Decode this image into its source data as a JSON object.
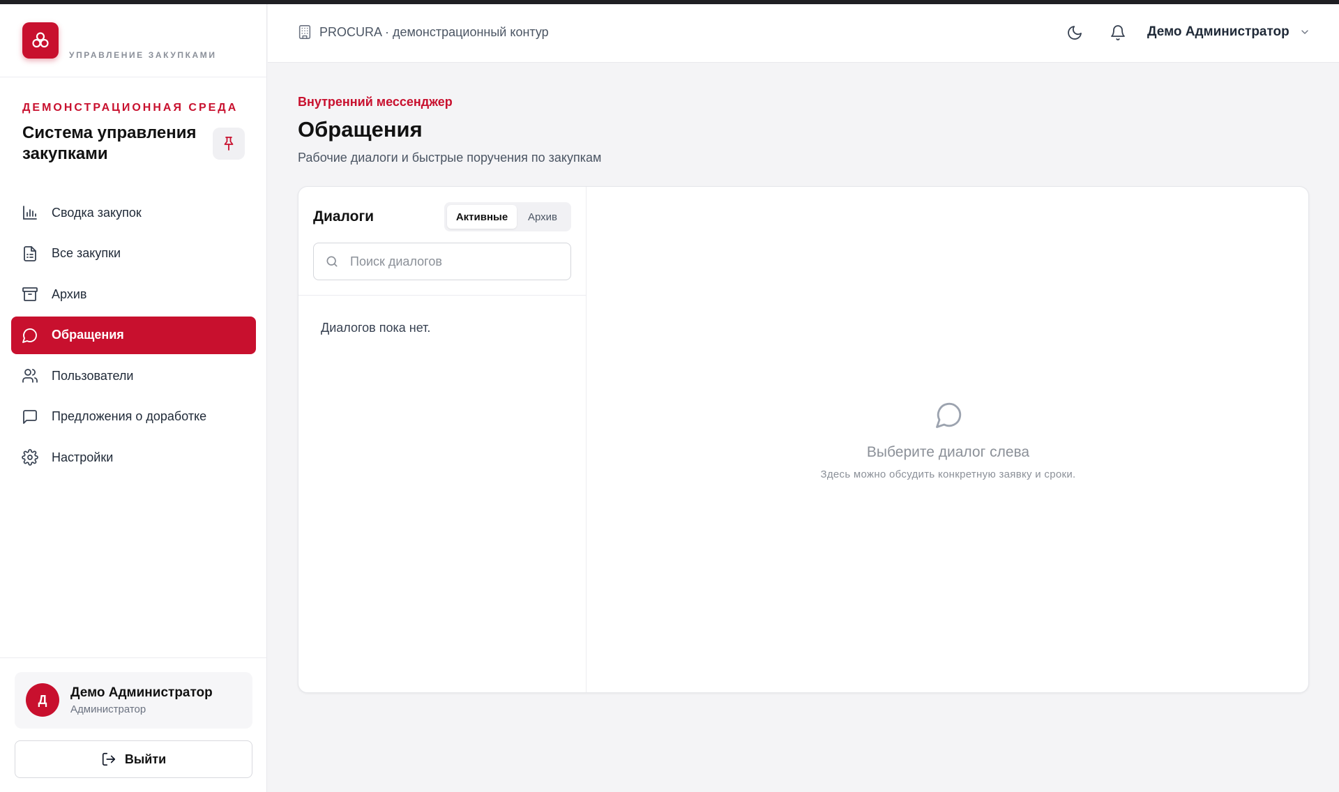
{
  "brand": {
    "subtitle": "УПРАВЛЕНИЕ ЗАКУПКАМИ",
    "accent_color": "#c8102e"
  },
  "sidebar": {
    "env_label": "ДЕМОНСТРАЦИОННАЯ СРЕДА",
    "system_title": "Система управления закупками",
    "items": [
      {
        "label": "Сводка закупок",
        "icon": "bar-chart-icon"
      },
      {
        "label": "Все закупки",
        "icon": "document-list-icon"
      },
      {
        "label": "Архив",
        "icon": "archive-icon"
      },
      {
        "label": "Обращения",
        "icon": "chat-bubble-icon",
        "active": true
      },
      {
        "label": "Пользователи",
        "icon": "users-icon"
      },
      {
        "label": "Предложения о доработке",
        "icon": "message-square-icon"
      },
      {
        "label": "Настройки",
        "icon": "gear-icon"
      }
    ],
    "user": {
      "initial": "Д",
      "name": "Демо Администратор",
      "role": "Администратор"
    },
    "logout_label": "Выйти"
  },
  "header": {
    "context": "PROCURA · демонстрационный контур",
    "user_name": "Демо Администратор"
  },
  "page": {
    "eyebrow": "Внутренний мессенджер",
    "title": "Обращения",
    "subtitle": "Рабочие диалоги и быстрые поручения по закупкам"
  },
  "dialogs": {
    "title": "Диалоги",
    "tabs": {
      "active": "Активные",
      "archive": "Архив"
    },
    "search_placeholder": "Поиск диалогов",
    "empty_text": "Диалогов пока нет."
  },
  "conversation": {
    "empty_title": "Выберите диалог слева",
    "empty_hint": "Здесь можно обсудить конкретную заявку и сроки."
  }
}
